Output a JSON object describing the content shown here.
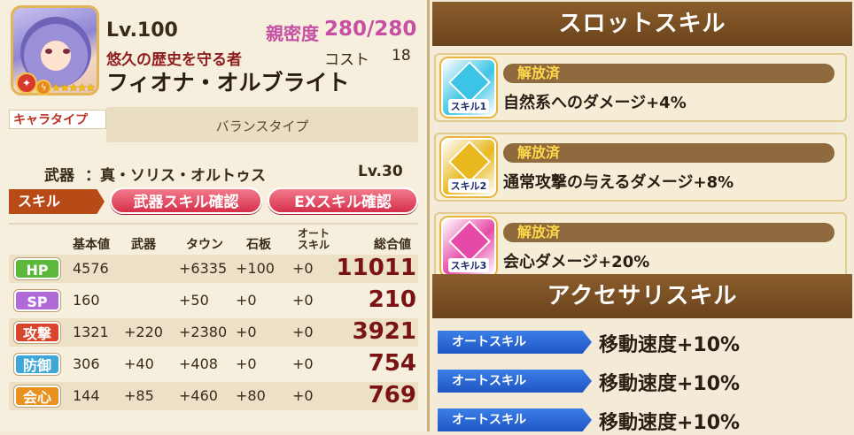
{
  "character": {
    "level": "Lv.100",
    "bond_label": "親密度",
    "bond_value": "280/280",
    "subtitle": "悠久の歴史を守る者",
    "cost_label": "コスト",
    "cost_value": "18",
    "name": "フィオナ・オルブライト",
    "stars": "★★★★★",
    "badge1": "✦",
    "badge2": "ϟ"
  },
  "type": {
    "label": "キャラタイプ",
    "value": "バランスタイプ"
  },
  "weapon": {
    "label": "武器",
    "name": "：真・ソリス・オルトゥス",
    "level": "Lv.30"
  },
  "skills": {
    "tag": "スキル",
    "weapon_skill_button": "武器スキル確認",
    "ex_skill_button": "EXスキル確認"
  },
  "stats": {
    "headers": {
      "base": "基本値",
      "weapon": "武器",
      "town": "タウン",
      "tablet": "石板",
      "auto": "オート\nスキル",
      "total": "総合値"
    },
    "rows": [
      {
        "name": "HP",
        "color": "#5cb83a",
        "base": "4576",
        "weapon": "",
        "town": "+6335",
        "tablet": "+100",
        "auto": "+0",
        "total": "11011"
      },
      {
        "name": "SP",
        "color": "#b06ad8",
        "base": "160",
        "weapon": "",
        "town": "+50",
        "tablet": "+0",
        "auto": "+0",
        "total": "210"
      },
      {
        "name": "攻撃",
        "color": "#d8452a",
        "base": "1321",
        "weapon": "+220",
        "town": "+2380",
        "tablet": "+0",
        "auto": "+0",
        "total": "3921"
      },
      {
        "name": "防御",
        "color": "#3fa6d8",
        "base": "306",
        "weapon": "+40",
        "town": "+408",
        "tablet": "+0",
        "auto": "+0",
        "total": "754"
      },
      {
        "name": "会心",
        "color": "#e8911e",
        "base": "144",
        "weapon": "+85",
        "town": "+460",
        "tablet": "+80",
        "auto": "+0",
        "total": "769"
      }
    ]
  },
  "slot_skills": {
    "title": "スロットスキル",
    "items": [
      {
        "status": "解放済",
        "label": "スキル1",
        "text": "自然系へのダメージ+4%",
        "color": "#3cc4e6"
      },
      {
        "status": "解放済",
        "label": "スキル2",
        "text": "通常攻撃の与えるダメージ+8%",
        "color": "#e8b81e"
      },
      {
        "status": "解放済",
        "label": "スキル3",
        "text": "会心ダメージ+20%",
        "color": "#e64aa8"
      }
    ]
  },
  "accessory_skills": {
    "title": "アクセサリスキル",
    "items": [
      {
        "tag": "オートスキル",
        "text": "移動速度+10%"
      },
      {
        "tag": "オートスキル",
        "text": "移動速度+10%"
      },
      {
        "tag": "オートスキル",
        "text": "移動速度+10%"
      }
    ]
  }
}
